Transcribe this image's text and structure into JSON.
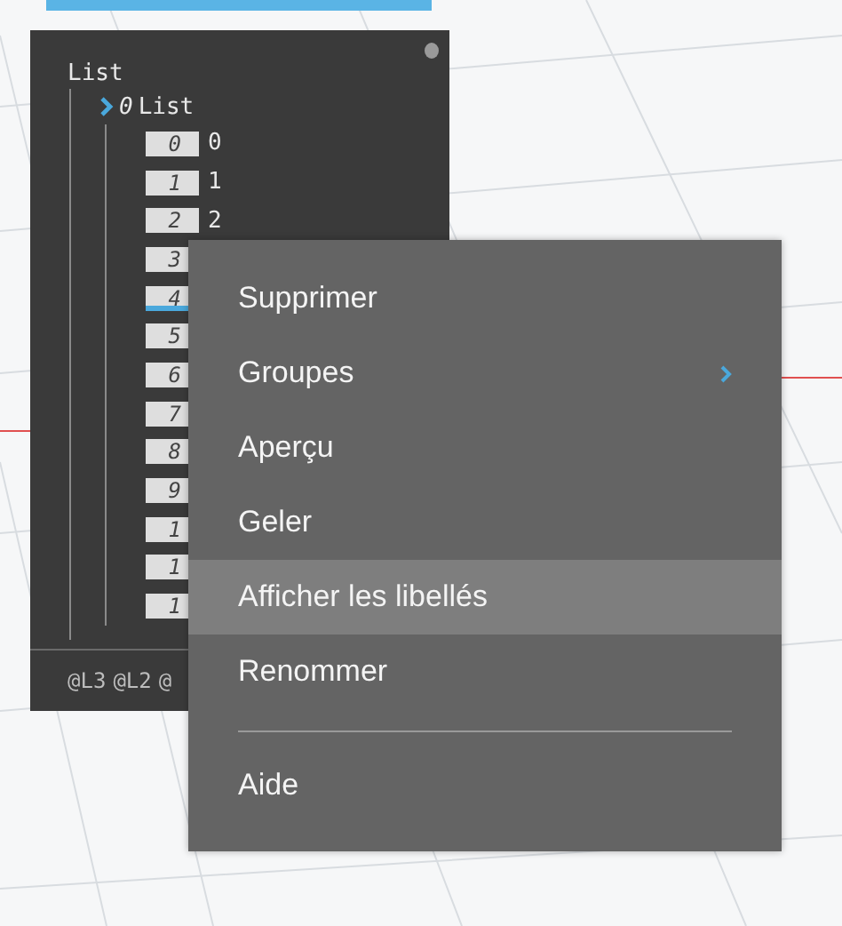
{
  "panel": {
    "title": "List",
    "sublist": {
      "index": "0",
      "label": "List",
      "items": [
        {
          "index": "0",
          "value": "0",
          "selected": false
        },
        {
          "index": "1",
          "value": "1",
          "selected": false
        },
        {
          "index": "2",
          "value": "2",
          "selected": false
        },
        {
          "index": "3",
          "selected": false
        },
        {
          "index": "4",
          "selected": true
        },
        {
          "index": "5",
          "selected": false
        },
        {
          "index": "6",
          "selected": false
        },
        {
          "index": "7",
          "selected": false
        },
        {
          "index": "8",
          "selected": false
        },
        {
          "index": "9",
          "selected": false
        },
        {
          "index": "1",
          "selected": false
        },
        {
          "index": "1",
          "selected": false
        },
        {
          "index": "1",
          "selected": false
        }
      ]
    },
    "footer": [
      "@L3",
      "@L2",
      "@"
    ]
  },
  "menu": {
    "items": [
      {
        "kind": "item",
        "label": "Supprimer",
        "highlighted": false,
        "submenu": false
      },
      {
        "kind": "item",
        "label": "Groupes",
        "highlighted": false,
        "submenu": true
      },
      {
        "kind": "item",
        "label": "Aperçu",
        "highlighted": false,
        "submenu": false
      },
      {
        "kind": "item",
        "label": "Geler",
        "highlighted": false,
        "submenu": false
      },
      {
        "kind": "item",
        "label": "Afficher les libellés",
        "highlighted": true,
        "submenu": false
      },
      {
        "kind": "item",
        "label": "Renommer",
        "highlighted": false,
        "submenu": false
      },
      {
        "kind": "separator"
      },
      {
        "kind": "item",
        "label": "Aide",
        "highlighted": false,
        "submenu": false
      }
    ]
  }
}
